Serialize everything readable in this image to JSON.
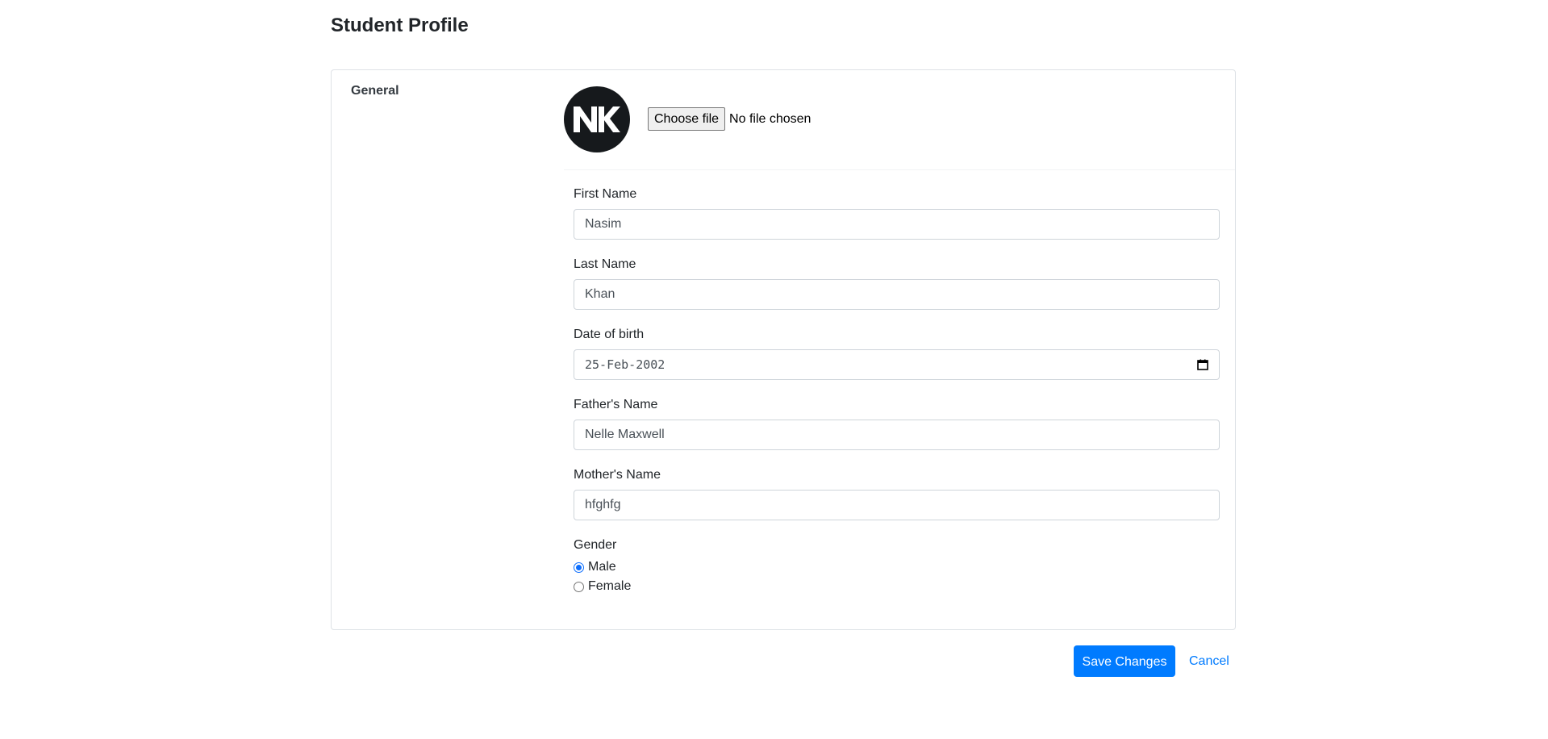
{
  "page": {
    "title": "Student Profile"
  },
  "card": {
    "section_label": "General",
    "avatar": {
      "initials": "NK",
      "background": "#16191c"
    },
    "file_input": {
      "button_label": "Choose file",
      "status": "No file chosen"
    }
  },
  "form": {
    "first_name": {
      "label": "First Name",
      "value": "Nasim"
    },
    "last_name": {
      "label": "Last Name",
      "value": "Khan"
    },
    "dob": {
      "label": "Date of birth",
      "value": "25-Feb-2002",
      "icon": "calendar-icon"
    },
    "father_name": {
      "label": "Father's Name",
      "value": "Nelle Maxwell"
    },
    "mother_name": {
      "label": "Mother's Name",
      "value": "hfghfg"
    },
    "gender": {
      "label": "Gender",
      "options": [
        {
          "label": "Male",
          "checked": true
        },
        {
          "label": "Female",
          "checked": false
        }
      ]
    }
  },
  "actions": {
    "save_label": "Save Changes",
    "cancel_label": "Cancel"
  },
  "colors": {
    "primary": "#007bff",
    "border": "#dee2e6",
    "input_border": "#ced4da"
  }
}
